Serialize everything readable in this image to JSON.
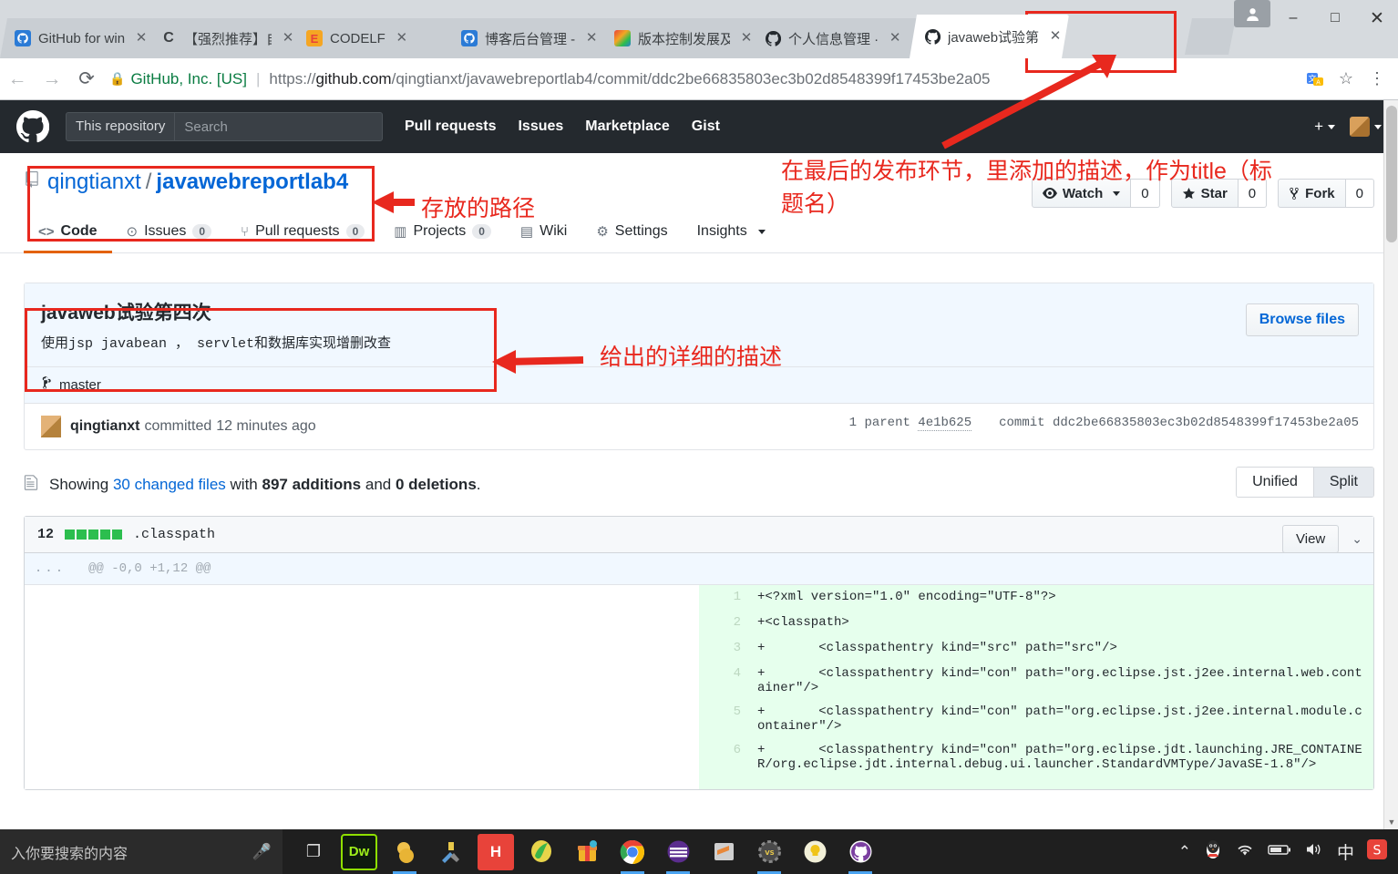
{
  "browser": {
    "tabs": [
      {
        "title": "GitHub for win",
        "favicon": "github-blue-icon",
        "active": false
      },
      {
        "title": "【强烈推荐】自",
        "favicon": "csdn-icon",
        "active": false
      },
      {
        "title": "CODELF",
        "favicon": "codelf-icon",
        "active": false
      },
      {
        "title": "博客后台管理 -",
        "favicon": "github-blue-icon",
        "active": false
      },
      {
        "title": "版本控制发展及",
        "favicon": "colorful-icon",
        "active": false
      },
      {
        "title": "个人信息管理 ·",
        "favicon": "github-dark-icon",
        "active": false
      },
      {
        "title": "javaweb试验第",
        "favicon": "github-dark-icon",
        "active": true
      }
    ],
    "window_controls": {
      "minimize": "–",
      "maximize": "□",
      "close": "✕"
    },
    "user_chip": "user-icon",
    "nav": {
      "back": "←",
      "forward": "→",
      "reload": "⟳"
    },
    "address": {
      "lock": "lock-icon",
      "site_identity": "GitHub, Inc. [US]",
      "url_prefix": "https://",
      "url_domain": "github.com",
      "url_path": "/qingtianxt/javawebreportlab4/commit/ddc2be66835803ec3b02d8548399f17453be2a05"
    },
    "omni_actions": [
      {
        "name": "translate-icon",
        "glyph": "文"
      },
      {
        "name": "bookmark-star-icon",
        "glyph": "☆"
      },
      {
        "name": "chrome-menu-icon",
        "glyph": "⋮"
      }
    ]
  },
  "github": {
    "header": {
      "logo": "github-mark-icon",
      "search_scope": "This repository",
      "search_placeholder": "Search",
      "search_value": "",
      "nav": [
        "Pull requests",
        "Issues",
        "Marketplace",
        "Gist"
      ],
      "plus_label": "+",
      "avatar": "avatar"
    },
    "repo": {
      "icon": "repo-icon",
      "owner": "qingtianxt",
      "separator": "/",
      "name": "javawebreportlab4",
      "actions": [
        {
          "icon": "eye-icon",
          "label": "Watch",
          "caret": true,
          "count": "0"
        },
        {
          "icon": "star-icon",
          "label": "Star",
          "caret": false,
          "count": "0"
        },
        {
          "icon": "fork-icon",
          "label": "Fork",
          "caret": false,
          "count": "0"
        }
      ],
      "tabs": [
        {
          "icon": "code-icon",
          "label": "Code",
          "count": null,
          "active": true
        },
        {
          "icon": "issue-opened-icon",
          "label": "Issues",
          "count": "0",
          "active": false
        },
        {
          "icon": "git-pull-request-icon",
          "label": "Pull requests",
          "count": "0",
          "active": false
        },
        {
          "icon": "project-icon",
          "label": "Projects",
          "count": "0",
          "active": false
        },
        {
          "icon": "book-icon",
          "label": "Wiki",
          "count": null,
          "active": false
        },
        {
          "icon": "gear-icon",
          "label": "Settings",
          "count": null,
          "active": false
        },
        {
          "icon": "graph-icon",
          "label": "Insights",
          "count": null,
          "active": false,
          "caret": true
        }
      ]
    },
    "commit": {
      "title": "javaweb试验第四次",
      "description": "使用jsp javabean ， servlet和数据库实现增删改查",
      "browse_files_label": "Browse files",
      "branch_icon": "git-branch-icon",
      "branch": "master",
      "author": "qingtianxt",
      "action_text": "committed",
      "time": "12 minutes ago",
      "parent_label": "1 parent",
      "parent_sha": "4e1b625",
      "commit_label": "commit",
      "commit_sha": "ddc2be66835803ec3b02d8548399f17453be2a05"
    },
    "diffstat": {
      "icon": "diff-file-icon",
      "showing": "Showing",
      "files_link": "30 changed files",
      "with": "with",
      "additions": "897 additions",
      "and": "and",
      "deletions": "0 deletions",
      "period": ".",
      "view_modes": [
        {
          "label": "Unified",
          "active": false
        },
        {
          "label": "Split",
          "active": true
        }
      ]
    },
    "file": {
      "changes": "12",
      "blocks": [
        "add",
        "add",
        "add",
        "add",
        "add"
      ],
      "name": ".classpath",
      "view_label": "View",
      "chevron": "chevron-down-icon",
      "hunk_gutter": "...",
      "hunk_header": "@@ -0,0 +1,12 @@",
      "lines": [
        {
          "num": "1",
          "code": "+<?xml version=\"1.0\" encoding=\"UTF-8\"?>"
        },
        {
          "num": "2",
          "code": "+<classpath>"
        },
        {
          "num": "3",
          "code": "+\t<classpathentry kind=\"src\" path=\"src\"/>"
        },
        {
          "num": "4",
          "code": "+\t<classpathentry kind=\"con\" path=\"org.eclipse.jst.j2ee.internal.web.container\"/>"
        },
        {
          "num": "5",
          "code": "+\t<classpathentry kind=\"con\" path=\"org.eclipse.jst.j2ee.internal.module.container\"/>"
        },
        {
          "num": "6",
          "code": "+\t<classpathentry kind=\"con\" path=\"org.eclipse.jdt.launching.JRE_CONTAINER/org.eclipse.jdt.internal.debug.ui.launcher.StandardVMType/JavaSE-1.8\"/>"
        }
      ]
    }
  },
  "annotations": {
    "color": "#e8281e",
    "notes": [
      {
        "name": "path-note",
        "text": "存放的路径"
      },
      {
        "name": "title-note-line1",
        "text": "在最后的发布环节，里添加的描述，作为title（标"
      },
      {
        "name": "title-note-line2",
        "text": "题名）"
      },
      {
        "name": "description-note",
        "text": "给出的详细的描述"
      }
    ]
  },
  "taskbar": {
    "search_placeholder": "入你要搜索的内容",
    "mic_icon": "microphone-icon",
    "task_view_icon": "task-view-icon",
    "apps": [
      {
        "name": "dreamweaver-icon",
        "glyph": "Dw",
        "running": false
      },
      {
        "name": "folder-app-icon",
        "glyph": "",
        "running": true
      },
      {
        "name": "tools-app-icon",
        "glyph": "",
        "running": false
      },
      {
        "name": "hbuilder-icon",
        "glyph": "H",
        "running": false
      },
      {
        "name": "music-app-icon",
        "glyph": "",
        "running": false
      },
      {
        "name": "gift-app-icon",
        "glyph": "",
        "running": false
      },
      {
        "name": "chrome-icon",
        "glyph": "",
        "running": true
      },
      {
        "name": "ubuntu-icon",
        "glyph": "",
        "running": true
      },
      {
        "name": "sublime-icon",
        "glyph": "S",
        "running": false
      },
      {
        "name": "settings-gear-icon",
        "glyph": "",
        "running": true
      },
      {
        "name": "lightbulb-icon",
        "glyph": "",
        "running": false
      },
      {
        "name": "github-desktop-icon",
        "glyph": "",
        "running": true
      }
    ],
    "tray": [
      {
        "name": "show-hidden-icons-chevron",
        "glyph": "⌃"
      },
      {
        "name": "qq-penguin-icon",
        "glyph": "🐧"
      },
      {
        "name": "wifi-icon",
        "glyph": "📶"
      },
      {
        "name": "battery-icon",
        "glyph": "🔋"
      },
      {
        "name": "volume-icon",
        "glyph": "🔊"
      },
      {
        "name": "ime-chinese-icon",
        "glyph": "中"
      },
      {
        "name": "sogou-input-icon",
        "glyph": "S"
      }
    ]
  }
}
